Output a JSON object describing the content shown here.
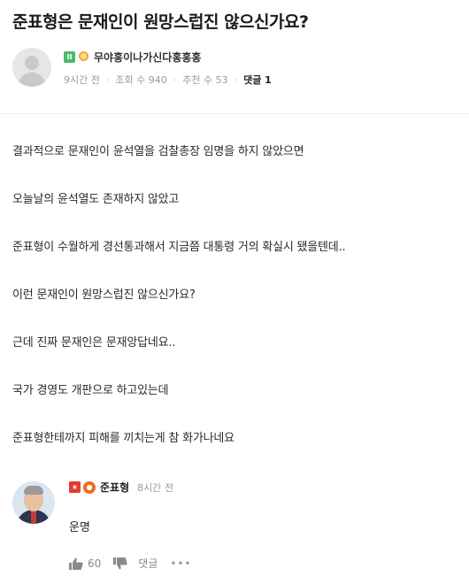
{
  "post": {
    "title": "준표형은 문재인이 원망스럽진 않으신가요?",
    "author": {
      "name": "무야홍이나가신다홍홍홍",
      "badge_letter": "II"
    },
    "meta": {
      "time": "9시간 전",
      "views": "조회 수 940",
      "recommends": "추천 수 53",
      "comments": "댓글 1"
    },
    "paragraphs": [
      "결과적으로 문재인이 윤석열을 검찰총장 임명을 하지 않았으면",
      "오늘날의 윤석열도 존재하지 않았고",
      "준표형이 수월하게 경선통과해서 지금쯤 대통령 거의 확실시 됐을텐데..",
      "이런 문재인이 원망스럽진 않으신가요?",
      "근데 진짜 문재인은 문재앙답네요..",
      "국가 경영도 개판으로 하고있는데",
      "준표형한테까지 피해를 끼치는게 참 화가나네요"
    ]
  },
  "comment": {
    "author": "준표형",
    "time": "8시간 전",
    "text": "운명",
    "likes": "60",
    "reply_label": "댓글",
    "more_label": "•••"
  },
  "colors": {
    "badge_green": "#4cb96b",
    "badge_red": "#e23c35",
    "badge_orange": "#ee6b1f"
  }
}
